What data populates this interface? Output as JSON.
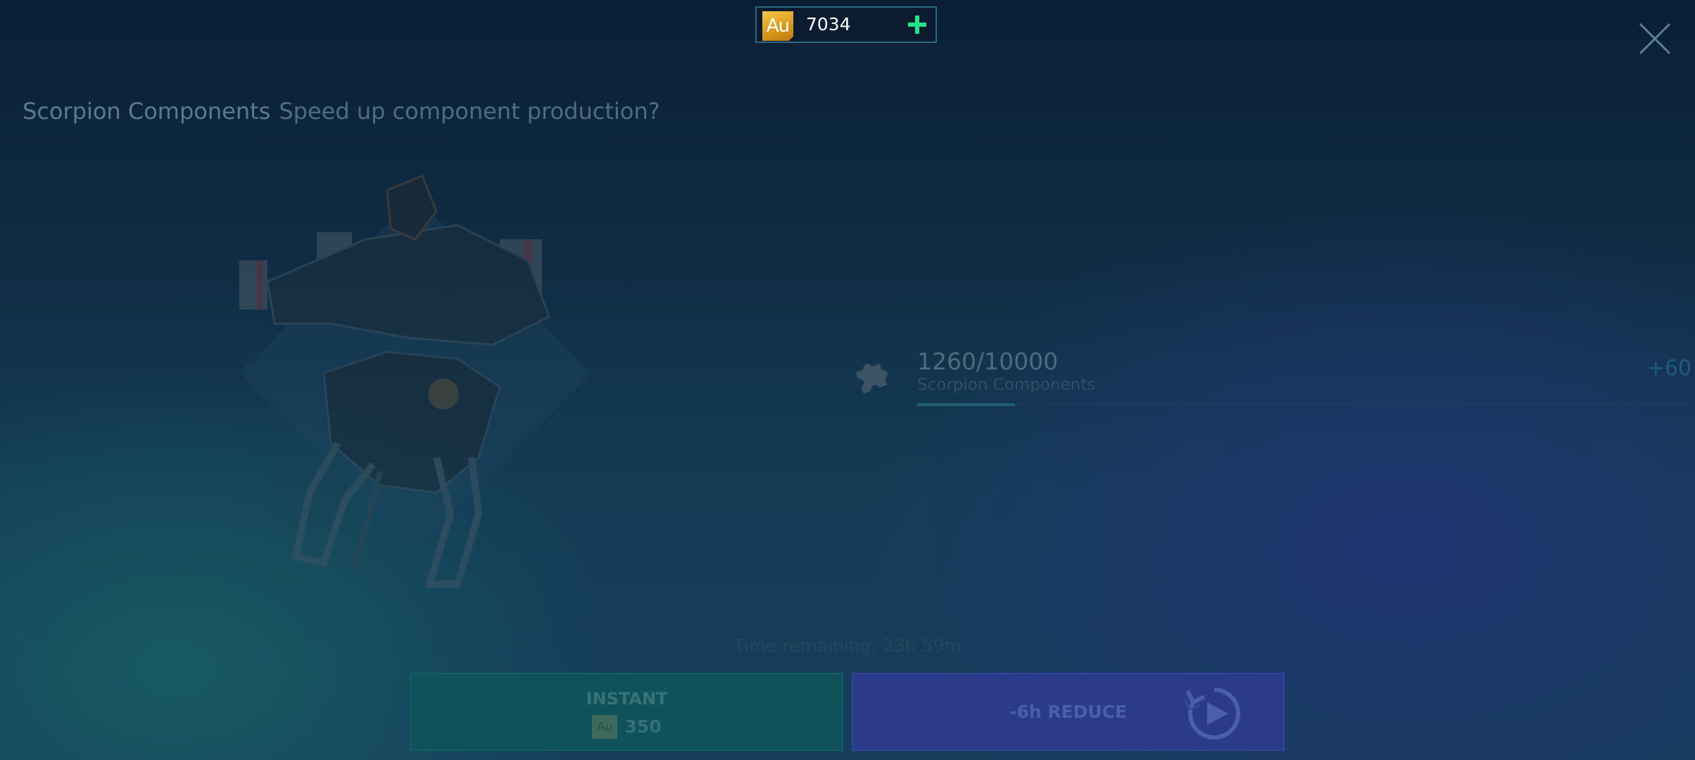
{
  "currency": {
    "badge": "Au",
    "amount": "7034"
  },
  "dialog": {
    "title": "Scorpion Components",
    "subtitle": "Speed up component production?"
  },
  "component": {
    "count": "1260/10000",
    "name": "Scorpion Components",
    "progress": 0.126,
    "gain": "+60"
  },
  "timer": {
    "text": "Time remaining: 23h 59m"
  },
  "actions": {
    "instant_label": "INSTANT",
    "instant_cost_badge": "Au",
    "instant_cost": "350",
    "reduce_label": "-6h REDUCE"
  },
  "icons": {
    "close": "close-icon",
    "add": "plus-icon",
    "component": "puzzle-piece-icon",
    "video": "play-video-icon"
  },
  "colors": {
    "accent_green": "#25e38a",
    "gold": "#e0a328",
    "instant_button": "#10525a",
    "reduce_button": "#2b3b8a"
  }
}
